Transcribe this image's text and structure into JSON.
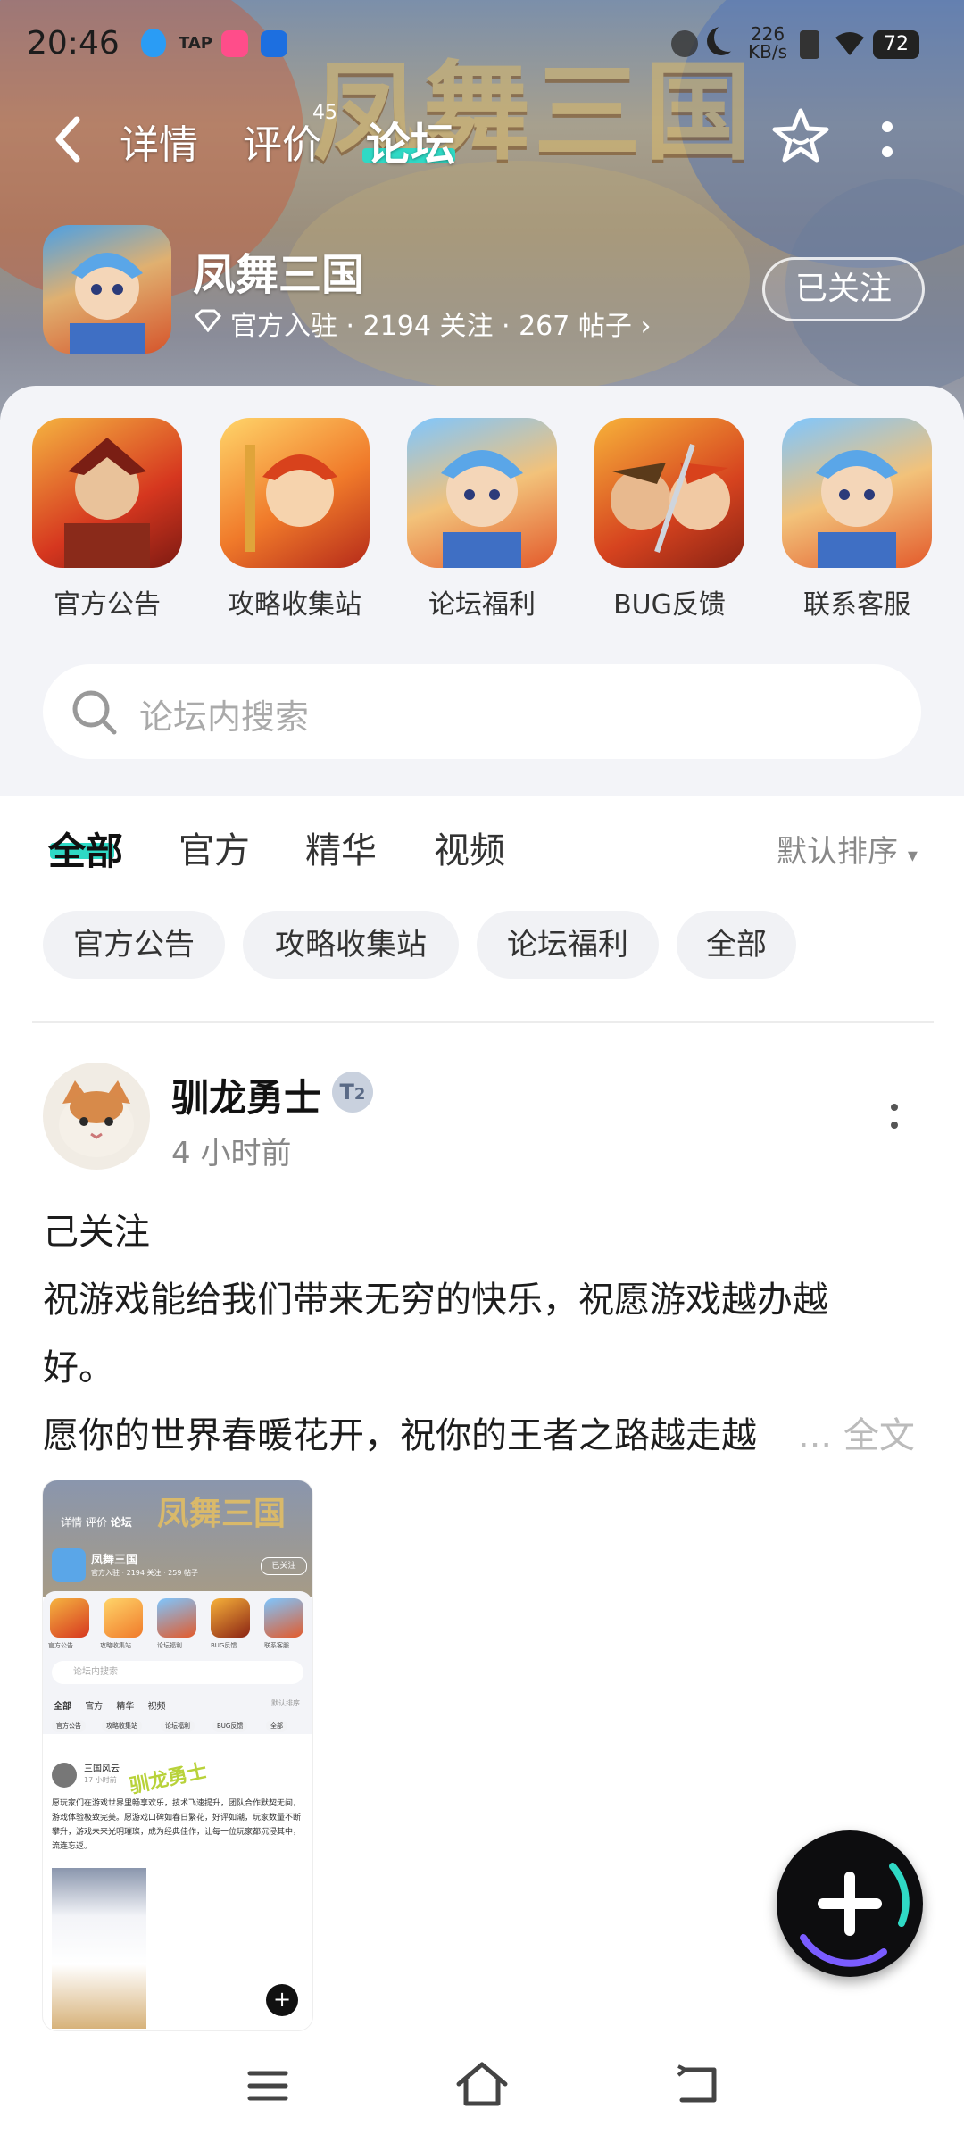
{
  "status_bar": {
    "time": "20:46",
    "network_speed_value": "226",
    "network_speed_unit": "KB/s",
    "battery": "72"
  },
  "top_nav": {
    "tab_detail": "详情",
    "tab_review": "评价",
    "review_badge": "45",
    "tab_forum": "论坛"
  },
  "app": {
    "name": "凤舞三国",
    "meta": "官方入驻 · 2194 关注 · 267 帖子",
    "follow_button": "已关注"
  },
  "shortcuts": [
    {
      "label": "官方公告"
    },
    {
      "label": "攻略收集站"
    },
    {
      "label": "论坛福利"
    },
    {
      "label": "BUG反馈"
    },
    {
      "label": "联系客服"
    }
  ],
  "search": {
    "placeholder": "论坛内搜索"
  },
  "feed_tabs": {
    "all": "全部",
    "official": "官方",
    "featured": "精华",
    "video": "视频",
    "sort": "默认排序"
  },
  "chips": [
    "官方公告",
    "攻略收集站",
    "论坛福利",
    "全部"
  ],
  "post": {
    "author": "驯龙勇士",
    "level": "2",
    "time": "4 小时前",
    "line1": "己关注",
    "line2": "祝游戏能给我们带来无穷的快乐，祝愿游戏越办越",
    "line3": "好。",
    "line4": "愿你的世界春暖花开，祝你的王者之路越走越",
    "more": "... 全文"
  },
  "thumb": {
    "nav_detail": "详情",
    "nav_review": "评价",
    "nav_forum": "论坛",
    "app_name": "凤舞三国",
    "follow": "已关注",
    "meta": "官方入驻 · 2194 关注 · 259 帖子",
    "labels": [
      "官方公告",
      "攻略收集站",
      "论坛福利",
      "BUG反馈",
      "联系客服"
    ],
    "search": "论坛内搜索",
    "tabs": [
      "全部",
      "官方",
      "精华",
      "视频"
    ],
    "sort": "默认排序",
    "chips": [
      "官方公告",
      "攻略收集站",
      "论坛福利",
      "BUG反馈",
      "全部"
    ],
    "post_author": "三国风云",
    "post_time": "17 小时前",
    "overlay": "驯龙勇士",
    "post_text": "愿玩家们在游戏世界里畅享欢乐，技术飞速提升，团队合作默契无间，游戏体验极致完美。愿游戏口碑如春日繁花，好评如潮，玩家数量不断攀升，游戏未来光明璀璨，成为经典佳作，让每一位玩家都沉浸其中，流连忘返。",
    "banner_title": "凤舞三国"
  },
  "colors": {
    "accent": "#2fd9c5",
    "fab_bg": "#0d0d0f"
  }
}
